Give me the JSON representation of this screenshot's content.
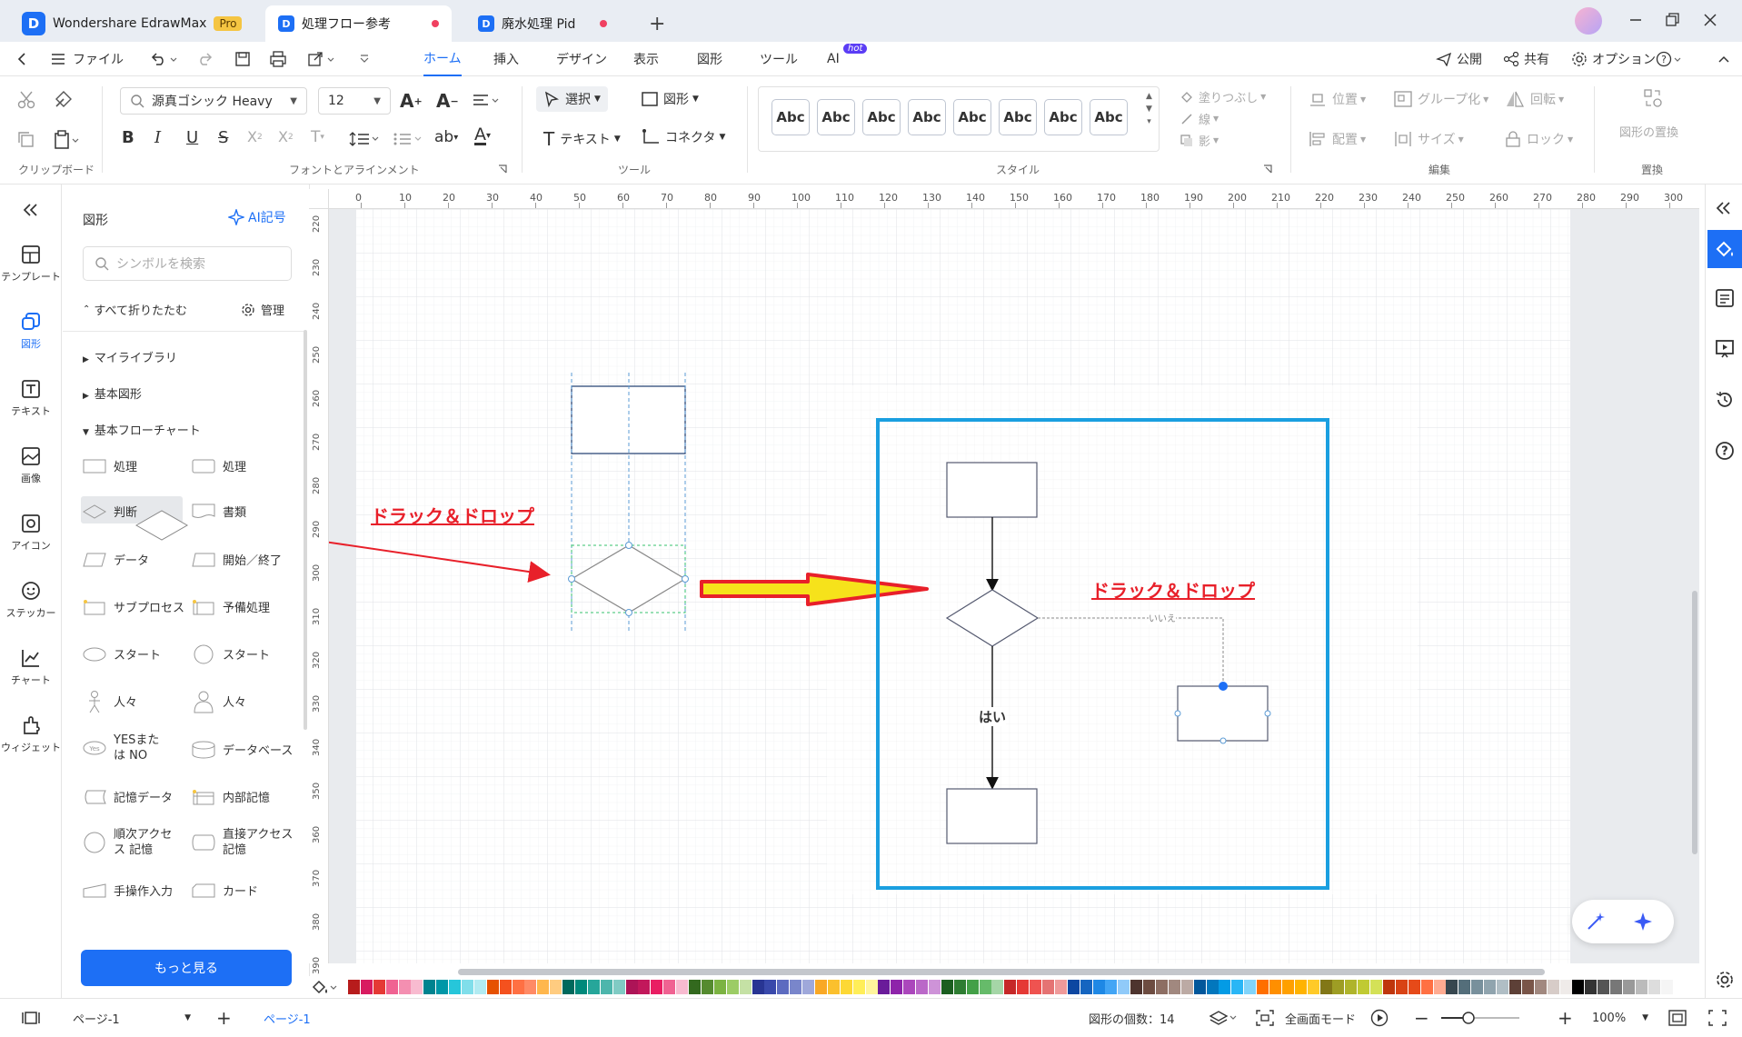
{
  "titlebar": {
    "app_name": "Wondershare EdrawMax",
    "pro_badge": "Pro",
    "tabs": [
      {
        "label": "処理フロー参考"
      },
      {
        "label": "廃水処理 Pid"
      }
    ],
    "new_tab": "+"
  },
  "menu": {
    "file": "ファイル",
    "items": [
      "ホーム",
      "挿入",
      "デザイン",
      "表示",
      "図形",
      "ツール",
      "AI"
    ],
    "ai_badge": "hot",
    "publish": "公開",
    "share": "共有",
    "options": "オプション"
  },
  "ribbon": {
    "groups": [
      "クリップボード",
      "フォントとアラインメント",
      "ツール",
      "スタイル",
      "編集",
      "置換"
    ],
    "font_name": "源真ゴシック Heavy",
    "font_size": "12",
    "select": "選択",
    "shape": "図形",
    "text": "テキスト",
    "connector": "コネクタ",
    "style_sample": "Abc",
    "fill": "塗りつぶし",
    "line": "線",
    "shadow": "影",
    "position": "位置",
    "group": "グループ化",
    "rotate": "回転",
    "align": "配置",
    "size": "サイズ",
    "lock": "ロック",
    "replace_shape": "図形の置換"
  },
  "leftrail": [
    {
      "label": "テンプレート",
      "icon": "template-icon"
    },
    {
      "label": "図形",
      "icon": "shapes-icon"
    },
    {
      "label": "テキスト",
      "icon": "text-icon"
    },
    {
      "label": "画像",
      "icon": "image-icon"
    },
    {
      "label": "アイコン",
      "icon": "icon-icon"
    },
    {
      "label": "ステッカー",
      "icon": "sticker-icon"
    },
    {
      "label": "チャート",
      "icon": "chart-icon"
    },
    {
      "label": "ウィジェット",
      "icon": "widget-icon"
    }
  ],
  "library": {
    "title": "図形",
    "ai_symbol": "AI記号",
    "search_placeholder": "シンボルを検索",
    "collapse_all": "すべて折りたたむ",
    "manage": "管理",
    "categories": [
      "マイライブラリ",
      "基本図形",
      "基本フローチャート"
    ],
    "shapes": [
      [
        "処理",
        "処理"
      ],
      [
        "判断",
        "書類"
      ],
      [
        "データ",
        "開始／終了"
      ],
      [
        "サブプロセス",
        "予備処理"
      ],
      [
        "スタート",
        "スタート"
      ],
      [
        "人々",
        "人々"
      ],
      [
        "YESまたは NO",
        "データベース"
      ],
      [
        "記憶データ",
        "内部記憶"
      ],
      [
        "順次アクセス 記憶",
        "直接アクセス 記憶"
      ],
      [
        "手操作入力",
        "カード"
      ]
    ],
    "more_button": "もっと見る"
  },
  "ruler": {
    "top": [
      "0",
      "10",
      "20",
      "30",
      "40",
      "50",
      "60",
      "70",
      "80",
      "90",
      "100",
      "110",
      "120",
      "130",
      "140",
      "150",
      "160",
      "170",
      "180",
      "190",
      "200",
      "210",
      "220",
      "230",
      "240",
      "250",
      "260",
      "270",
      "280",
      "290",
      "300"
    ],
    "left": [
      "220",
      "230",
      "240",
      "250",
      "260",
      "270",
      "280",
      "290",
      "300",
      "310",
      "320",
      "330",
      "340",
      "350",
      "360",
      "370",
      "380",
      "390"
    ]
  },
  "canvas": {
    "annotation_1": "ドラック＆ドロップ",
    "annotation_2": "ドラック＆ドロップ",
    "label_yes": "はい",
    "label_no": "いいえ",
    "accent_red": "#e8202a",
    "highlight_blue": "#1a9fe0",
    "arrow_yellow": "#f6e21b"
  },
  "statusbar": {
    "page_select": "ページ-1",
    "page_tab": "ページ-1",
    "shape_count": "図形の個数：14",
    "fullscreen": "全画面モード",
    "zoom": "100%"
  }
}
